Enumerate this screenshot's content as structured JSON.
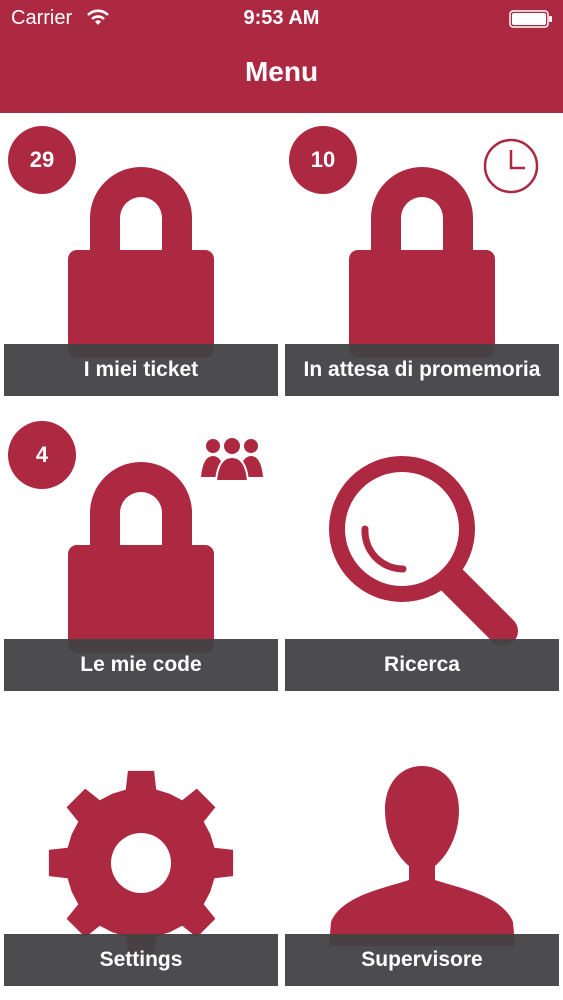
{
  "status_bar": {
    "carrier": "Carrier",
    "time": "9:53 AM"
  },
  "header": {
    "title": "Menu"
  },
  "tiles": [
    {
      "label": "I miei ticket",
      "badge": "29",
      "icon": "lock-icon"
    },
    {
      "label": "In attesa di promemoria",
      "badge": "10",
      "icon": "lock-icon",
      "secondary_icon": "clock-icon"
    },
    {
      "label": "Le mie code",
      "badge": "4",
      "icon": "lock-icon",
      "secondary_icon": "group-icon"
    },
    {
      "label": "Ricerca",
      "icon": "magnifier-icon"
    },
    {
      "label": "Settings",
      "icon": "gear-icon"
    },
    {
      "label": "Supervisore",
      "icon": "person-icon"
    }
  ],
  "colors": {
    "accent": "#ad2941",
    "label_bar": "#424244",
    "background": "#ffffff"
  }
}
